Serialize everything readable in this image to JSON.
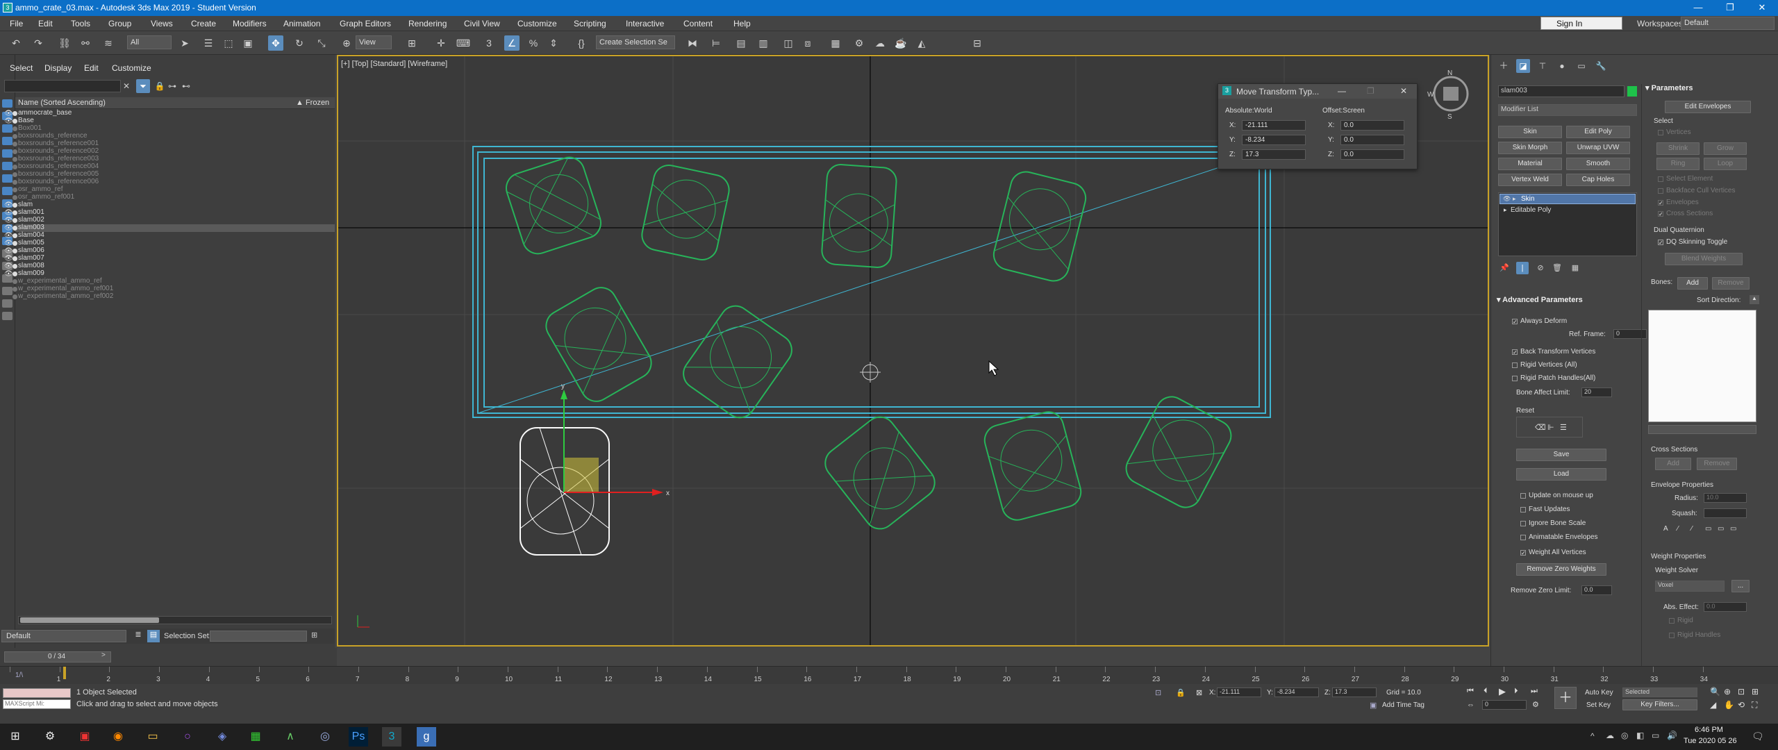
{
  "window": {
    "title": "ammo_crate_03.max - Autodesk 3ds Max 2019 - Student Version",
    "app_icon": "3"
  },
  "menu": [
    "File",
    "Edit",
    "Tools",
    "Group",
    "Views",
    "Create",
    "Modifiers",
    "Animation",
    "Graph Editors",
    "Rendering",
    "Civil View",
    "Customize",
    "Scripting",
    "Interactive",
    "Content",
    "Help"
  ],
  "account": {
    "signin": "Sign In",
    "workspaces_label": "Workspaces:",
    "workspace": "Default"
  },
  "toolbar": {
    "filter": "All",
    "ref_coord": "View",
    "selection_set": "Create Selection Se"
  },
  "scene_explorer": {
    "tabs": [
      "Select",
      "Display",
      "Edit",
      "Customize"
    ],
    "col_name": "Name (Sorted Ascending)",
    "col_frozen": "▲ Frozen",
    "rows": [
      {
        "name": "ammocrate_base",
        "hidden": false,
        "sel": false
      },
      {
        "name": "Base",
        "hidden": false,
        "sel": false
      },
      {
        "name": "Box001",
        "hidden": true,
        "sel": false
      },
      {
        "name": "boxsrounds_reference",
        "hidden": true,
        "sel": false
      },
      {
        "name": "boxsrounds_reference001",
        "hidden": true,
        "sel": false
      },
      {
        "name": "boxsrounds_reference002",
        "hidden": true,
        "sel": false
      },
      {
        "name": "boxsrounds_reference003",
        "hidden": true,
        "sel": false
      },
      {
        "name": "boxsrounds_reference004",
        "hidden": true,
        "sel": false
      },
      {
        "name": "boxsrounds_reference005",
        "hidden": true,
        "sel": false
      },
      {
        "name": "boxsrounds_reference006",
        "hidden": true,
        "sel": false
      },
      {
        "name": "osr_ammo_ref",
        "hidden": true,
        "sel": false
      },
      {
        "name": "osr_ammo_ref001",
        "hidden": true,
        "sel": false
      },
      {
        "name": "slam",
        "hidden": false,
        "sel": false
      },
      {
        "name": "slam001",
        "hidden": false,
        "sel": false
      },
      {
        "name": "slam002",
        "hidden": false,
        "sel": false
      },
      {
        "name": "slam003",
        "hidden": false,
        "sel": true
      },
      {
        "name": "slam004",
        "hidden": false,
        "sel": false
      },
      {
        "name": "slam005",
        "hidden": false,
        "sel": false
      },
      {
        "name": "slam006",
        "hidden": false,
        "sel": false
      },
      {
        "name": "slam007",
        "hidden": false,
        "sel": false
      },
      {
        "name": "slam008",
        "hidden": false,
        "sel": false
      },
      {
        "name": "slam009",
        "hidden": false,
        "sel": false
      },
      {
        "name": "w_experimental_ammo_ref",
        "hidden": true,
        "sel": false
      },
      {
        "name": "w_experimental_ammo_ref001",
        "hidden": true,
        "sel": false
      },
      {
        "name": "w_experimental_ammo_ref002",
        "hidden": true,
        "sel": false
      }
    ],
    "layer": "Default",
    "selection_set_label": "Selection Set:"
  },
  "viewport": {
    "label": "[+] [Top] [Standard] [Wireframe]",
    "compass": "Top"
  },
  "move_transform": {
    "title": "Move Transform Typ...",
    "absolute": "Absolute:World",
    "offset": "Offset:Screen",
    "abs_x": "-21.111",
    "abs_y": "-8.234",
    "abs_z": "17.3",
    "off_x": "0.0",
    "off_y": "0.0",
    "off_z": "0.0"
  },
  "command_panel": {
    "object_name": "slam003",
    "modifier_list": "Modifier List",
    "mod_buttons": [
      "Skin",
      "Edit Poly",
      "Skin Morph",
      "Unwrap UVW",
      "Material",
      "Smooth",
      "Vertex Weld",
      "Cap Holes"
    ],
    "stack": [
      "Skin",
      "Editable Poly"
    ],
    "advanced": {
      "title": "Advanced Parameters",
      "always_deform": "Always Deform",
      "ref_frame": "Ref. Frame:",
      "ref_frame_val": "0",
      "back_transform": "Back Transform Vertices",
      "rigid_vertices": "Rigid Vertices (All)",
      "rigid_patch": "Rigid Patch Handles(All)",
      "bone_affect": "Bone Affect Limit:",
      "bone_affect_val": "20",
      "reset": "Reset",
      "save": "Save",
      "load": "Load",
      "update_mouse": "Update on mouse up",
      "fast_updates": "Fast Updates",
      "ignore_bone_scale": "Ignore Bone Scale",
      "animatable_env": "Animatable Envelopes",
      "weight_all": "Weight All Vertices",
      "remove_zero": "Remove Zero Weights",
      "remove_zero_limit": "Remove Zero Limit:",
      "remove_zero_limit_val": "0.0"
    },
    "params": {
      "title": "Parameters",
      "edit_envelopes": "Edit Envelopes",
      "select": "Select",
      "vertices": "Vertices",
      "shrink": "Shrink",
      "grow": "Grow",
      "ring": "Ring",
      "loop": "Loop",
      "select_element": "Select Element",
      "backface": "Backface Cull Vertices",
      "envelopes": "Envelopes",
      "cross_sections": "Cross Sections",
      "dual_q": "Dual Quaternion",
      "dq_toggle": "DQ Skinning Toggle",
      "blend_weights": "Blend Weights",
      "bones": "Bones:",
      "add": "Add",
      "remove": "Remove",
      "sort_direction": "Sort Direction:",
      "cs_title": "Cross Sections",
      "cs_add": "Add",
      "cs_remove": "Remove",
      "env_props": "Envelope Properties",
      "radius": "Radius:",
      "radius_val": "10.0",
      "squash": "Squash:",
      "weight_props": "Weight Properties",
      "weight_solver": "Weight Solver",
      "voxel": "Voxel",
      "abs_effect": "Abs. Effect:",
      "abs_effect_val": "0.0",
      "rigid": "Rigid",
      "rigid_handles": "Rigid Handles"
    }
  },
  "timeline": {
    "frame": "0 / 34",
    "ticks": [
      "0",
      "1",
      "2",
      "3",
      "4",
      "5",
      "6",
      "7",
      "8",
      "9",
      "10",
      "11",
      "12",
      "13",
      "14",
      "15",
      "16",
      "17",
      "18",
      "19",
      "20",
      "21",
      "22",
      "23",
      "24",
      "25",
      "26",
      "27",
      "28",
      "29",
      "30",
      "31",
      "32",
      "33",
      "34"
    ],
    "slider_label": "1/\\"
  },
  "status": {
    "selected": "1 Object Selected",
    "prompt": "Click and drag to select and move objects",
    "maxscript": "MAXScript Mi:",
    "x": "-21.111",
    "y": "-8.234",
    "z": "17.3",
    "grid": "Grid = 10.0",
    "add_time_tag": "Add Time Tag",
    "autokey": "Auto Key",
    "setkey": "Set Key",
    "selected_mode": "Selected",
    "key_filters": "Key Filters...",
    "frame_val": "0"
  },
  "taskbar": {
    "time": "6:46 PM",
    "date": "Tue 2020 05 26"
  }
}
